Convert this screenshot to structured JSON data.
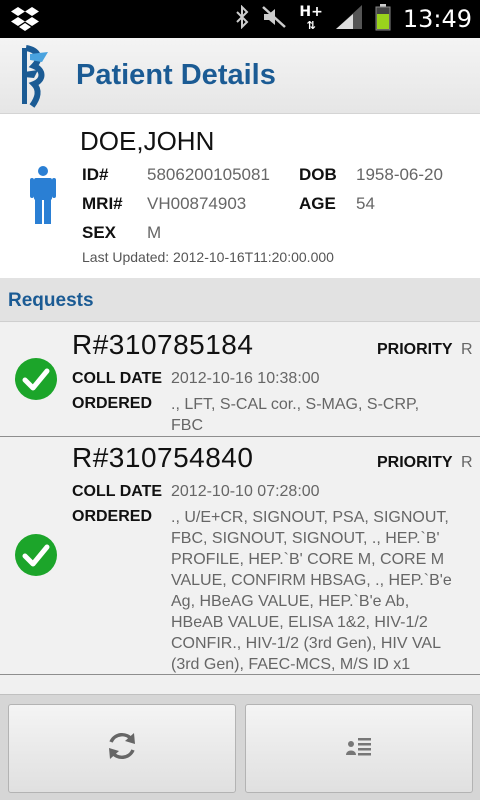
{
  "status_bar": {
    "time": "13:49",
    "network": "H+",
    "icons": [
      "dropbox-icon",
      "bluetooth-icon",
      "mute-icon",
      "signal-icon",
      "battery-icon"
    ]
  },
  "header": {
    "title": "Patient Details"
  },
  "patient": {
    "name": "DOE,JOHN",
    "id_label": "ID#",
    "id": "5806200105081",
    "dob_label": "DOB",
    "dob": "1958-06-20",
    "mri_label": "MRI#",
    "mri": "VH00874903",
    "age_label": "AGE",
    "age": "54",
    "sex_label": "SEX",
    "sex": "M",
    "last_updated": "Last Updated: 2012-10-16T11:20:00.000"
  },
  "requests": {
    "heading": "Requests",
    "items": [
      {
        "number": "R#310785184",
        "priority_label": "PRIORITY",
        "priority": "R",
        "coll_label": "COLL DATE",
        "coll_date": "2012-10-16 10:38:00",
        "ordered_label": "ORDERED",
        "ordered_lines": [
          ".,  LFT, S-CAL cor., S-MAG, S-CRP,",
          "FBC"
        ]
      },
      {
        "number": "R#310754840",
        "priority_label": "PRIORITY",
        "priority": "R",
        "coll_label": "COLL DATE",
        "coll_date": "2012-10-10 07:28:00",
        "ordered_label": "ORDERED",
        "ordered_lines": [
          "., U/E+CR, SIGNOUT, PSA, SIGNOUT,",
          "FBC, SIGNOUT, SIGNOUT, ., HEP.`B'",
          "PROFILE, HEP.`B' CORE M, CORE M",
          "VALUE, CONFIRM HBSAG, ., HEP.`B'e",
          "Ag, HBeAG VALUE, HEP.`B'e Ab,",
          "HBeAB VALUE, ELISA 1&2, HIV-1/2",
          "CONFIR., HIV-1/2 (3rd Gen), HIV VAL",
          "(3rd Gen), FAEC-MCS, M/S ID x1"
        ]
      }
    ]
  },
  "bottom_bar": {
    "buttons": [
      "refresh-icon",
      "patient-notes-icon"
    ]
  },
  "colors": {
    "accent": "#1b5b94",
    "check_green": "#1ca52a",
    "person_blue": "#2a7fd4"
  }
}
